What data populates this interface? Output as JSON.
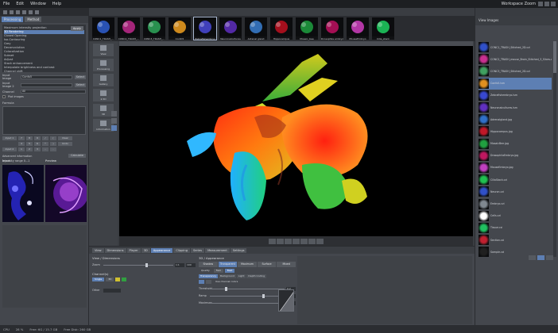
{
  "menubar": {
    "items": [
      "File",
      "Edit",
      "Window",
      "Help"
    ],
    "workspace": "Workspace Zoom"
  },
  "left_panel": {
    "tabs": [
      "Processing",
      "Method"
    ],
    "apply_label": "Apply",
    "methods": [
      "Maximum intensity projection",
      "3D Rendering",
      "Closed Opening",
      "Iso-Contouring",
      "Grey",
      "Deconvolution",
      "Colocalization",
      "Subset",
      "Adjust",
      "Stack enhancement",
      "Interpolate brightness and contrast",
      "Channel shift"
    ],
    "selected_method_index": 1,
    "input_image_label": "Input Image",
    "input_image_value": "Confo5",
    "input_image2_label": "Input Image 2",
    "select_label": "Select",
    "channel_label": "Channel",
    "channel_value": "All",
    "plot_images_label": "Plot images",
    "formula_label": "Formula",
    "input1_label": "Input 1",
    "input2_label": "Input 2",
    "clear_label": "Clear",
    "undo_label": "Undo",
    "calculate_label": "Calculate",
    "advanced_label": "Advanced information",
    "intensity_label": "Intensity range 0...1",
    "thumb_labels": [
      "Input",
      "Preview"
    ]
  },
  "thumbstrip": {
    "items": [
      {
        "label": "CONC1_TRASH_...",
        "color": "#2f5fd0"
      },
      {
        "label": "CONC2_TRASH_...",
        "color": "#c02a8c"
      },
      {
        "label": "CONC3_TRASH_...",
        "color": "#2fa85a"
      },
      {
        "label": "Confo5",
        "color": "#f0a020"
      },
      {
        "label": "Zebrafishembryo",
        "color": "#4a4ad8"
      },
      {
        "label": "Neuronalcultures",
        "color": "#5f2fbf"
      },
      {
        "label": "Adrenal gland",
        "color": "#3a7fd0"
      },
      {
        "label": "Hippocampus",
        "color": "#c01020"
      },
      {
        "label": "Mosaic_bee",
        "color": "#1fa040"
      },
      {
        "label": "Drosophila embryo",
        "color": "#c01060"
      },
      {
        "label": "MouseEmbryo",
        "color": "#d040c0"
      },
      {
        "label": "Cilia_stack",
        "color": "#1fd060"
      }
    ],
    "selected_index": 4
  },
  "vtools": [
    {
      "label": "View",
      "icon": "view-icon"
    },
    {
      "label": "Processing",
      "icon": "processing-icon"
    },
    {
      "label": "Gallery",
      "icon": "gallery-icon"
    },
    {
      "label": "2.5D",
      "icon": "2.5d-icon"
    },
    {
      "label": "3D",
      "icon": "3d-icon"
    },
    {
      "label": "Information",
      "icon": "info-icon"
    }
  ],
  "bottom_panel": {
    "tabs": [
      "View",
      "Dimensions",
      "Player",
      "3D",
      "Appearance",
      "Clipping",
      "Series",
      "Measurement",
      "Settings"
    ],
    "active_tab_index": 4,
    "left_header": "View / Dimensions",
    "zoom_label": "Zoom",
    "zoom_value": "1:1",
    "zoom_percent": "100",
    "channels_label": "Channel(s)",
    "channel_buttons": [
      "Single",
      "3D"
    ],
    "other_label": "Other",
    "right_header": "3D / Appearance",
    "render_modes": [
      "Shadow",
      "Transparent",
      "Maximum",
      "Surface",
      "Mixed"
    ],
    "active_render_mode": 1,
    "quality_label": "Quality",
    "quality_options": [
      "Fast",
      "Best"
    ],
    "subtabs": [
      "Transparency",
      "Background",
      "Light",
      "Depth Coding"
    ],
    "threshold_label": "Threshold",
    "threshold_value": "0.2",
    "ramp_label": "Ramp",
    "ramp_value": "70.0",
    "max_label": "Maximum",
    "max_value": "100.0",
    "use_channel_label": "Use channel colors"
  },
  "right_panel": {
    "header": "View Images",
    "items": [
      {
        "name": "CONC1_TRASH_Stitched_2D.czi",
        "color": "#3050c8"
      },
      {
        "name": "CONC2_TRASH_mouse_Brain_Stitched_3_Slices.czi",
        "color": "#c83090"
      },
      {
        "name": "CONC3_TRASH_Stitched_2D.czi",
        "color": "#40a060"
      },
      {
        "name": "Confo5.lsm",
        "color": "#e09020"
      },
      {
        "name": "Zebrafishembryo.lsm",
        "color": "#3848d0"
      },
      {
        "name": "Neuronalcultures.lsm",
        "color": "#6030c0"
      },
      {
        "name": "Adrenalgland.jpg",
        "color": "#3070c8"
      },
      {
        "name": "Hippocampus.jpg",
        "color": "#c01828"
      },
      {
        "name": "MosaicBee.jpg",
        "color": "#20a040"
      },
      {
        "name": "DrosophilaEmbryo.jpg",
        "color": "#c01860"
      },
      {
        "name": "MouseEmbryo.jpg",
        "color": "#c040c0"
      },
      {
        "name": "CiliaStack.czi",
        "color": "#20c050"
      },
      {
        "name": "Neuron.czi",
        "color": "#3050c8"
      },
      {
        "name": "Embryo.czi",
        "color": "#808890"
      },
      {
        "name": "Cells.czi",
        "color": "#ffffff"
      },
      {
        "name": "Tissue.czi",
        "color": "#20c060"
      },
      {
        "name": "Section.czi",
        "color": "#c02030"
      },
      {
        "name": "Sample.czi",
        "color": "#202020"
      }
    ],
    "selected_index": 3
  },
  "statusbar": {
    "items": [
      "CPU",
      "28 %",
      "Free: 6G / 15.7 GB"
    ],
    "sub": "Free Disk: 260 GB"
  },
  "colors": {
    "accent": "#5d7fb3",
    "panel": "#44474d",
    "dark": "#2a2c30"
  }
}
